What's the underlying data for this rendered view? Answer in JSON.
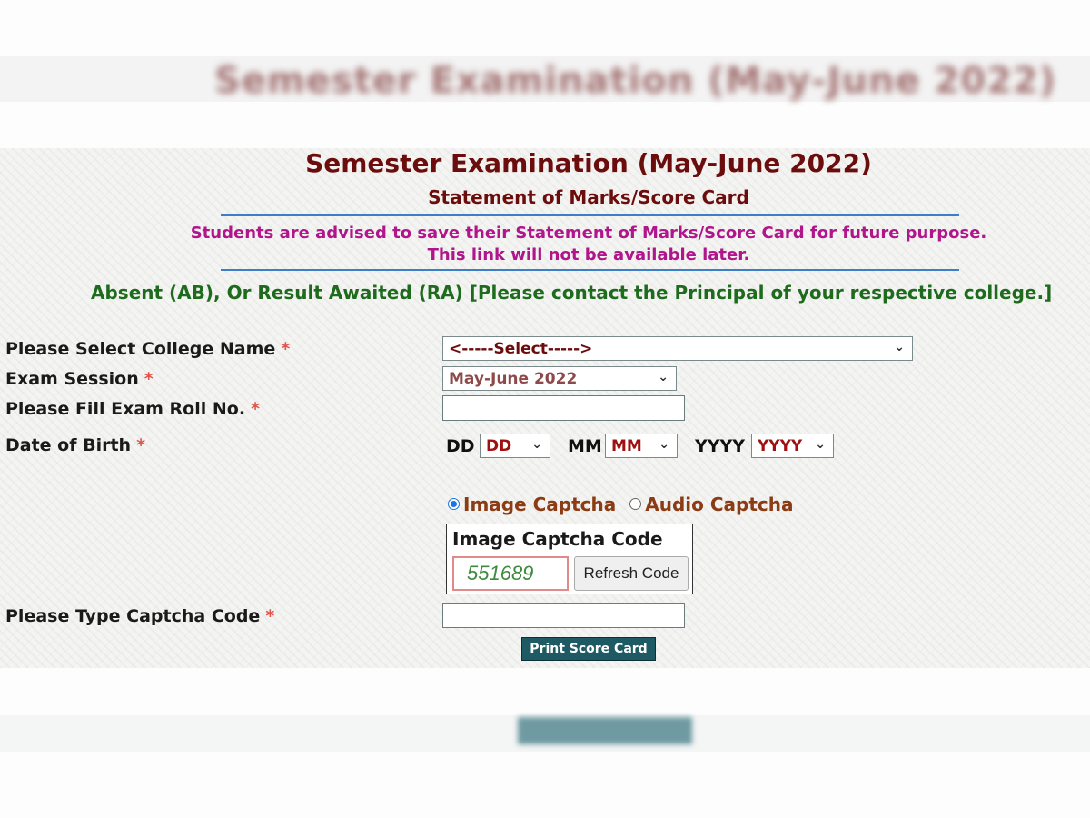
{
  "blurred_header": {
    "text": "Semester Examination (May-June 2022)"
  },
  "header": {
    "title": "Semester Examination (May-June 2022)",
    "subtitle": "Statement of Marks/Score Card"
  },
  "notice": {
    "line1": "Students are advised to save their Statement of Marks/Score Card for future purpose.",
    "line2": "This link will not be available later."
  },
  "info_line": "Absent (AB), Or Result Awaited (RA) [Please contact the Principal of your respective college.]",
  "form": {
    "college": {
      "label": "Please Select College Name",
      "required_mark": "*",
      "selected": "<-----Select----->"
    },
    "session": {
      "label": "Exam Session",
      "required_mark": "*",
      "selected": "May-June 2022"
    },
    "roll_no": {
      "label": "Please Fill Exam Roll No.",
      "required_mark": "*",
      "value": ""
    },
    "dob": {
      "label": "Date of Birth",
      "required_mark": "*",
      "day_label": "DD",
      "day_selected": "DD",
      "month_label": "MM",
      "month_selected": "MM",
      "year_label": "YYYY",
      "year_selected": "YYYY"
    },
    "captcha_type": {
      "options": [
        {
          "label": "Image Captcha",
          "selected": true
        },
        {
          "label": "Audio Captcha",
          "selected": false
        }
      ]
    },
    "captcha_box": {
      "title": "Image Captcha Code",
      "code": "551689",
      "refresh_label": "Refresh Code"
    },
    "captcha_input": {
      "label": "Please Type Captcha Code",
      "required_mark": "*",
      "value": ""
    },
    "submit_label": "Print Score Card"
  },
  "icons": {
    "chevron": "⌄"
  },
  "colors": {
    "title": "#6b0d0d",
    "notice": "#b0158c",
    "info": "#1e6b1e",
    "divider": "#3d7fc6",
    "required": "#e0544a",
    "radio_label": "#8b3c14",
    "submit_bg": "#1e5a63"
  }
}
